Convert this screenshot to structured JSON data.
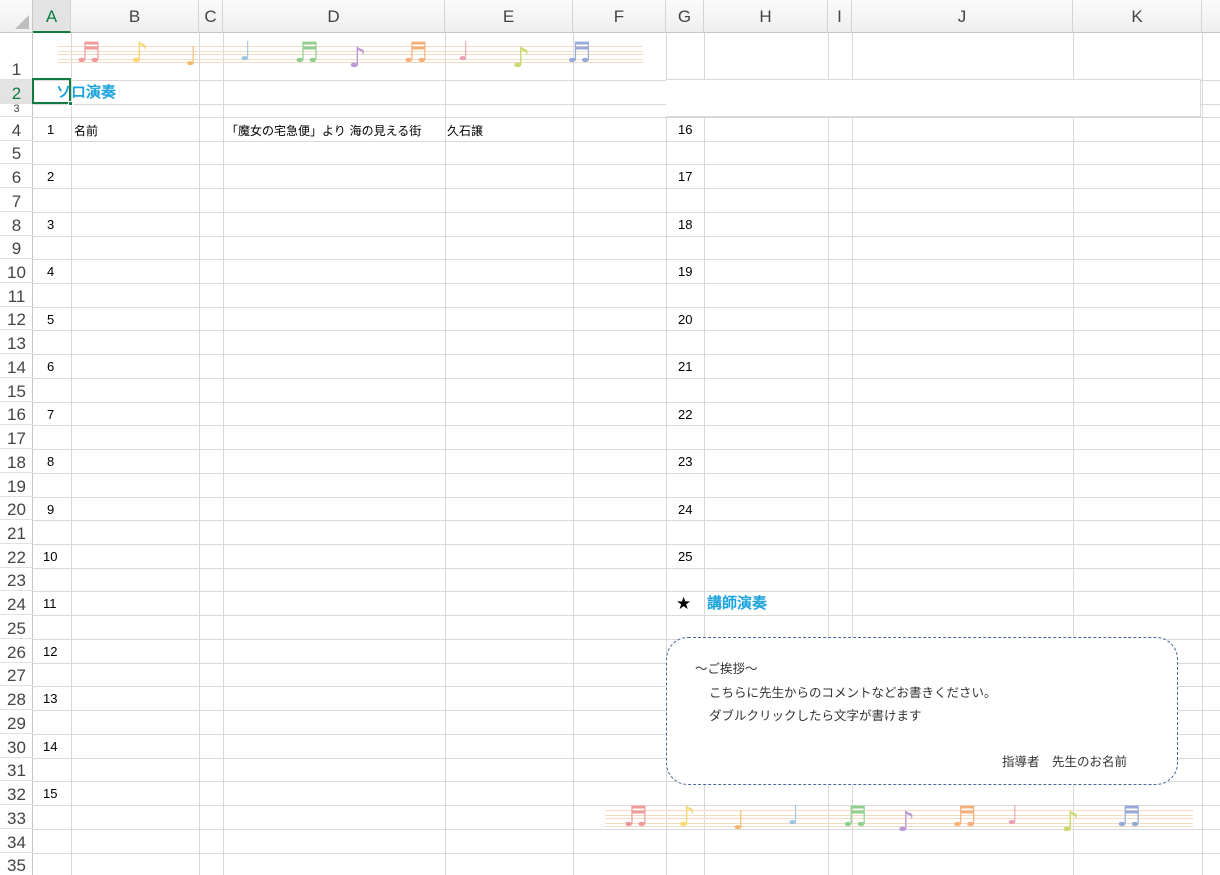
{
  "columns": [
    "A",
    "B",
    "C",
    "D",
    "E",
    "F",
    "G",
    "H",
    "I",
    "J",
    "K"
  ],
  "selected": {
    "column": "A",
    "row": "2"
  },
  "rows": [
    "1",
    "2",
    "3",
    "4",
    "5",
    "6",
    "7",
    "8",
    "9",
    "10",
    "11",
    "12",
    "13",
    "14",
    "15",
    "16",
    "17",
    "18",
    "19",
    "20",
    "21",
    "22",
    "23",
    "24",
    "25",
    "26",
    "27",
    "28",
    "29",
    "30",
    "31",
    "32",
    "33",
    "34",
    "35"
  ],
  "heading_solo": "ソロ演奏",
  "heading_teacher": "講師演奏",
  "star": "★",
  "left_numbers": [
    "1",
    "2",
    "3",
    "4",
    "5",
    "6",
    "7",
    "8",
    "9",
    "10",
    "11",
    "12",
    "13",
    "14",
    "15"
  ],
  "right_numbers": [
    "16",
    "17",
    "18",
    "19",
    "20",
    "21",
    "22",
    "23",
    "24",
    "25"
  ],
  "entry1": {
    "name": "名前",
    "piece": "「魔女の宅急便」より 海の見える街",
    "composer": "久石譲"
  },
  "greeting": {
    "title": "～ご挨拶～",
    "line1": "こちらに先生からのコメントなどお書きください。",
    "line2": "ダブルクリックしたら文字が書けます",
    "signature": "指導者　先生のお名前"
  },
  "note_glyphs": [
    "♬",
    "♪",
    "♩",
    "♩",
    "♬",
    "♪",
    "♬",
    "♩",
    "♪",
    "♬"
  ],
  "note_colors": [
    "#ef9a9a",
    "#f7d774",
    "#f5b86a",
    "#9fc3e0",
    "#8fcf8f",
    "#b99ad4",
    "#f5b07a",
    "#e8a0b4",
    "#c9d86a",
    "#97a9d6"
  ]
}
